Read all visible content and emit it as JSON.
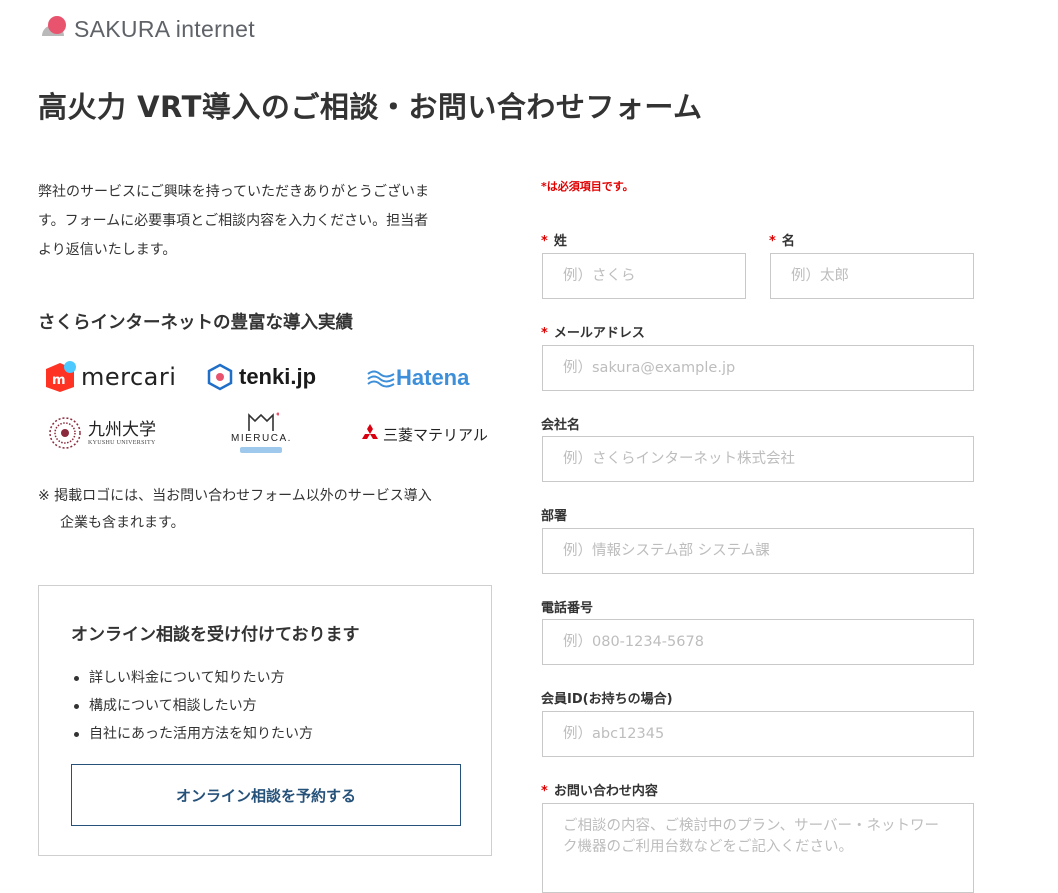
{
  "header": {
    "brand": "SAKURA internet"
  },
  "page": {
    "title": "高火力 VRT導入のご相談・お問い合わせフォーム"
  },
  "intro": {
    "line1": "弊社のサービスにご興味を持っていただきありがとうございま",
    "line2": "す。フォームに必要事項とご相談内容を入力ください。担当者",
    "line3": "より返信いたします。"
  },
  "achievements": {
    "title": "さくらインターネットの豊富な導入実績",
    "logos": {
      "mercari": "mercari",
      "tenki": "tenki.jp",
      "hatena": "Hatena",
      "kyushu_main": "九州大学",
      "kyushu_sub": "KYUSHU UNIVERSITY",
      "mieruca": "MIERUCA.",
      "mitsubishi": "三菱マテリアル"
    },
    "note_line1": "※ 掲載ロゴには、当お問い合わせフォーム以外のサービス導入",
    "note_line2": "企業も含まれます。"
  },
  "consult_card": {
    "title": "オンライン相談を受け付けております",
    "items": [
      "詳しい料金について知りたい方",
      "構成について相談したい方",
      "自社にあった活用方法を知りたい方"
    ],
    "button_label": "オンライン相談を予約する"
  },
  "form": {
    "required_note": "*は必須項目です。",
    "required_mark": "*",
    "last_name": {
      "label": "姓",
      "placeholder": "例）さくら"
    },
    "first_name": {
      "label": "名",
      "placeholder": "例）太郎"
    },
    "email": {
      "label": "メールアドレス",
      "placeholder": "例）sakura@example.jp"
    },
    "company": {
      "label": "会社名",
      "placeholder": "例）さくらインターネット株式会社"
    },
    "department": {
      "label": "部署",
      "placeholder": "例）情報システム部 システム課"
    },
    "phone": {
      "label": "電話番号",
      "placeholder": "例）080-1234-5678"
    },
    "member_id": {
      "label": "会員ID(お持ちの場合)",
      "placeholder": "例）abc12345"
    },
    "inquiry": {
      "label": "お問い合わせ内容",
      "placeholder": "ご相談の内容、ご検討中のプラン、サーバー・ネットワーク機器のご利用台数などをご記入ください。"
    }
  },
  "colors": {
    "accent": "#26527a",
    "required": "#e00000",
    "logo_pink": "#e8546e",
    "mercari_red": "#ff3324",
    "hatena_blue": "#3d8fd9",
    "tenki_blue": "#1f6fc9",
    "mitsubishi_red": "#d9000f"
  }
}
